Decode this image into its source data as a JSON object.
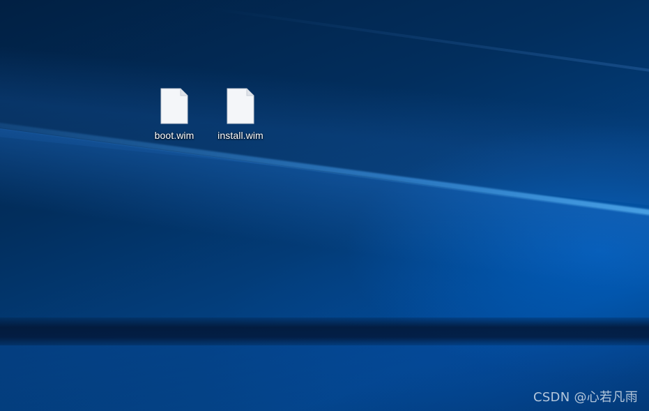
{
  "desktop": {
    "icons": [
      {
        "label": "boot.wim",
        "icon": "blank-file-icon"
      },
      {
        "label": "install.wim",
        "icon": "blank-file-icon"
      }
    ],
    "watermark": "CSDN @心若凡雨"
  },
  "colors": {
    "wallpaper_dark": "#012043",
    "wallpaper_mid": "#033e7c",
    "wallpaper_light": "#0a7ae0",
    "label_text": "#ffffff"
  }
}
